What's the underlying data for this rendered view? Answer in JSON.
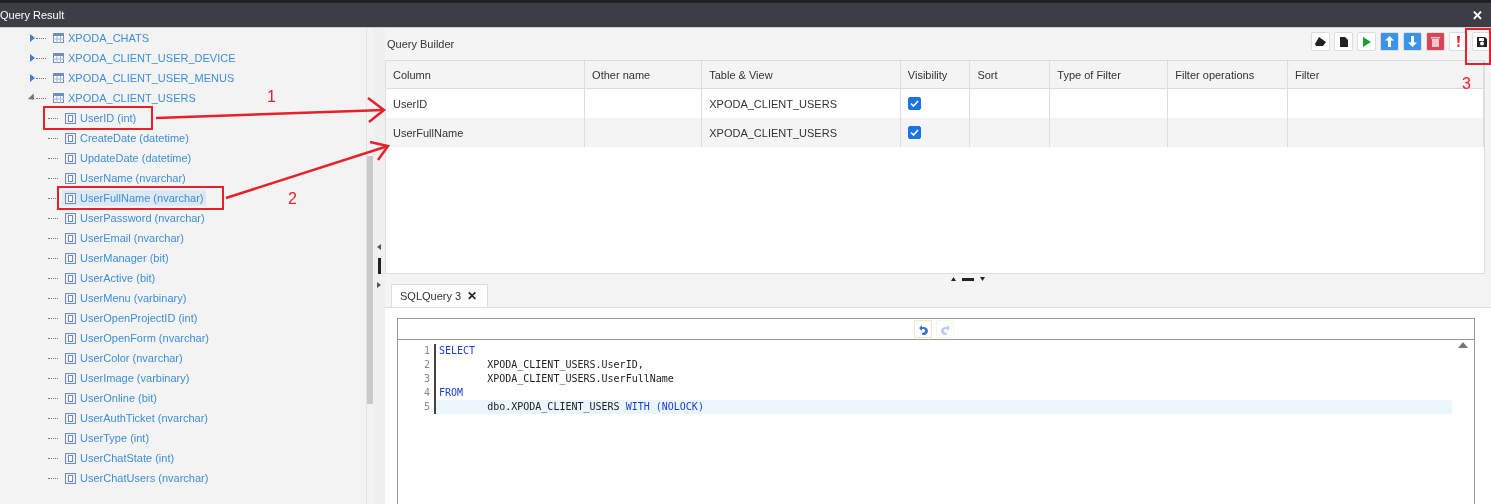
{
  "window": {
    "title": "Query Result",
    "close": "✕"
  },
  "tree": {
    "items": [
      {
        "label": "XPODA_CHATS",
        "expanded": false
      },
      {
        "label": "XPODA_CLIENT_USER_DEVICE",
        "expanded": false
      },
      {
        "label": "XPODA_CLIENT_USER_MENUS",
        "expanded": false
      },
      {
        "label": "XPODA_CLIENT_USERS",
        "expanded": true,
        "children": [
          {
            "label": "UserID (int)",
            "selected": false
          },
          {
            "label": "CreateDate (datetime)",
            "selected": false
          },
          {
            "label": "UpdateDate (datetime)",
            "selected": false
          },
          {
            "label": "UserName (nvarchar)",
            "selected": false
          },
          {
            "label": "UserFullName (nvarchar)",
            "selected": true
          },
          {
            "label": "UserPassword (nvarchar)",
            "selected": false
          },
          {
            "label": "UserEmail (nvarchar)",
            "selected": false
          },
          {
            "label": "UserManager (bit)",
            "selected": false
          },
          {
            "label": "UserActive (bit)",
            "selected": false
          },
          {
            "label": "UserMenu (varbinary)",
            "selected": false
          },
          {
            "label": "UserOpenProjectID (int)",
            "selected": false
          },
          {
            "label": "UserOpenForm (nvarchar)",
            "selected": false
          },
          {
            "label": "UserColor (nvarchar)",
            "selected": false
          },
          {
            "label": "UserImage (varbinary)",
            "selected": false
          },
          {
            "label": "UserOnline (bit)",
            "selected": false
          },
          {
            "label": "UserAuthTicket (nvarchar)",
            "selected": false
          },
          {
            "label": "UserType (int)",
            "selected": false
          },
          {
            "label": "UserChatState (int)",
            "selected": false
          },
          {
            "label": "UserChatUsers (nvarchar)",
            "selected": false
          }
        ]
      }
    ]
  },
  "query_builder": {
    "title": "Query Builder",
    "toolbar": [
      {
        "kind": "clear"
      },
      {
        "kind": "new"
      },
      {
        "kind": "run"
      },
      {
        "kind": "up"
      },
      {
        "kind": "down"
      },
      {
        "kind": "delete"
      },
      {
        "kind": "warning"
      },
      {
        "kind": "save"
      }
    ],
    "table": {
      "columns": [
        "Column",
        "Other name",
        "Table & View",
        "Visibility",
        "Sort",
        "Type of Filter",
        "Filter operations",
        "Filter"
      ],
      "rows": [
        {
          "column": "UserID",
          "table": "XPODA_CLIENT_USERS",
          "visible": true
        },
        {
          "column": "UserFullName",
          "table": "XPODA_CLIENT_USERS",
          "visible": true
        }
      ]
    }
  },
  "editor": {
    "tabs": [
      {
        "label": "SQLQuery 3",
        "selected": true,
        "close": "✕"
      }
    ],
    "lines": [
      {
        "number": "1",
        "current": false,
        "segments": [
          {
            "text": "SELECT",
            "kind": "keyword"
          }
        ]
      },
      {
        "number": "2",
        "current": false,
        "segments": [
          {
            "text": "        XPODA_CLIENT_USERS.UserID,",
            "kind": "plain"
          }
        ]
      },
      {
        "number": "3",
        "current": false,
        "segments": [
          {
            "text": "        XPODA_CLIENT_USERS.UserFullName",
            "kind": "plain"
          }
        ]
      },
      {
        "number": "4",
        "current": false,
        "segments": [
          {
            "text": "FROM",
            "kind": "keyword"
          }
        ]
      },
      {
        "number": "5",
        "current": true,
        "segments": [
          {
            "text": "        dbo.XPODA_CLIENT_USERS ",
            "kind": "plain"
          },
          {
            "text": "WITH (NOLOCK)",
            "kind": "keyword"
          }
        ]
      }
    ]
  },
  "annotations": [
    {
      "label": "1"
    },
    {
      "label": "2"
    },
    {
      "label": "3"
    }
  ]
}
